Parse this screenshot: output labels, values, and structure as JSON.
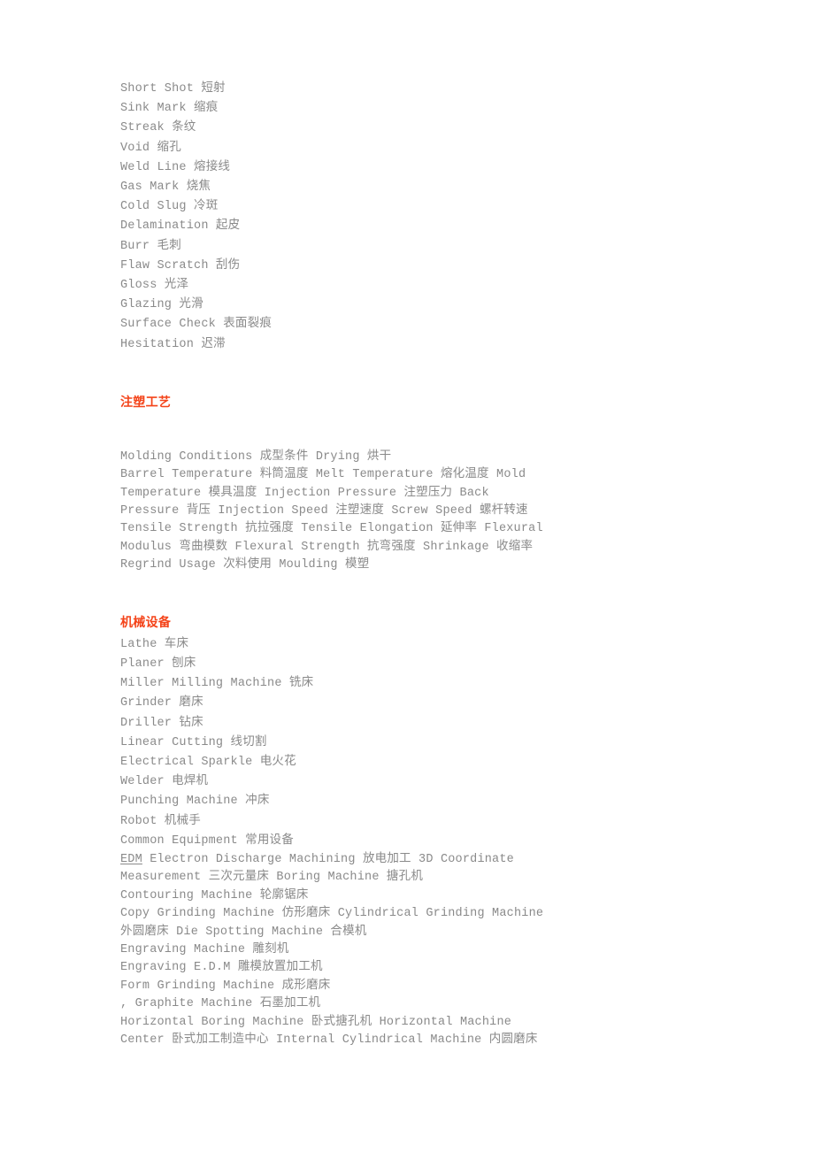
{
  "document": {
    "colors": {
      "body_text": "#8a8a8a",
      "heading": "#f4441a",
      "background": "#ffffff"
    },
    "defect_terms": [
      "Short Shot 短射",
      "Sink Mark 缩痕",
      "Streak 条纹",
      "Void 缩孔",
      "Weld Line 熔接线",
      "Gas Mark 烧焦",
      "Cold Slug 冷斑",
      "Delamination 起皮",
      "Burr 毛刺",
      "Flaw Scratch 刮伤",
      "Gloss 光泽",
      "Glazing 光滑",
      "Surface Check 表面裂痕",
      "Hesitation 迟滞"
    ],
    "section_molding": {
      "heading": "注塑工艺",
      "paragraph_lines": [
        "Molding Conditions 成型条件 Drying 烘干",
        "Barrel Temperature 料筒温度 Melt Temperature 熔化温度 Mold Temperature 模具温度 Injection Pressure 注塑压力 Back Pressure 背压 Injection Speed 注塑速度 Screw Speed 螺杆转速 Tensile Strength 抗拉强度 Tensile Elongation 延伸率 Flexural Modulus 弯曲模数 Flexural Strength 抗弯强度 Shrinkage 收缩率 Regrind Usage 次料使用 Moulding 模塑"
      ]
    },
    "section_machinery": {
      "heading": "机械设备",
      "simple_terms": [
        "Lathe 车床",
        "Planer 刨床",
        "Miller Milling Machine 铣床",
        "Grinder 磨床",
        "Driller 钻床",
        "Linear Cutting 线切割",
        "Electrical Sparkle 电火花",
        "Welder 电焊机",
        "Punching Machine 冲床",
        "Robot 机械手",
        "Common Equipment 常用设备"
      ],
      "edm_entry": {
        "abbreviation": "EDM",
        "rest": " Electron Discharge Machining 放电加工 3D Coordinate Measurement 三次元量床 Boring Machine 搪孔机"
      },
      "tail_terms": [
        "Contouring Machine 轮廓锯床",
        "Copy Grinding Machine 仿形磨床 Cylindrical Grinding Machine 外圆磨床 Die Spotting Machine 合模机",
        "Engraving Machine 雕刻机",
        "Engraving E.D.M 雕模放置加工机",
        "Form Grinding Machine 成形磨床",
        ", Graphite Machine 石墨加工机",
        "Horizontal Boring Machine 卧式搪孔机 Horizontal Machine Center 卧式加工制造中心 Internal Cylindrical Machine 内圆磨床"
      ]
    }
  }
}
